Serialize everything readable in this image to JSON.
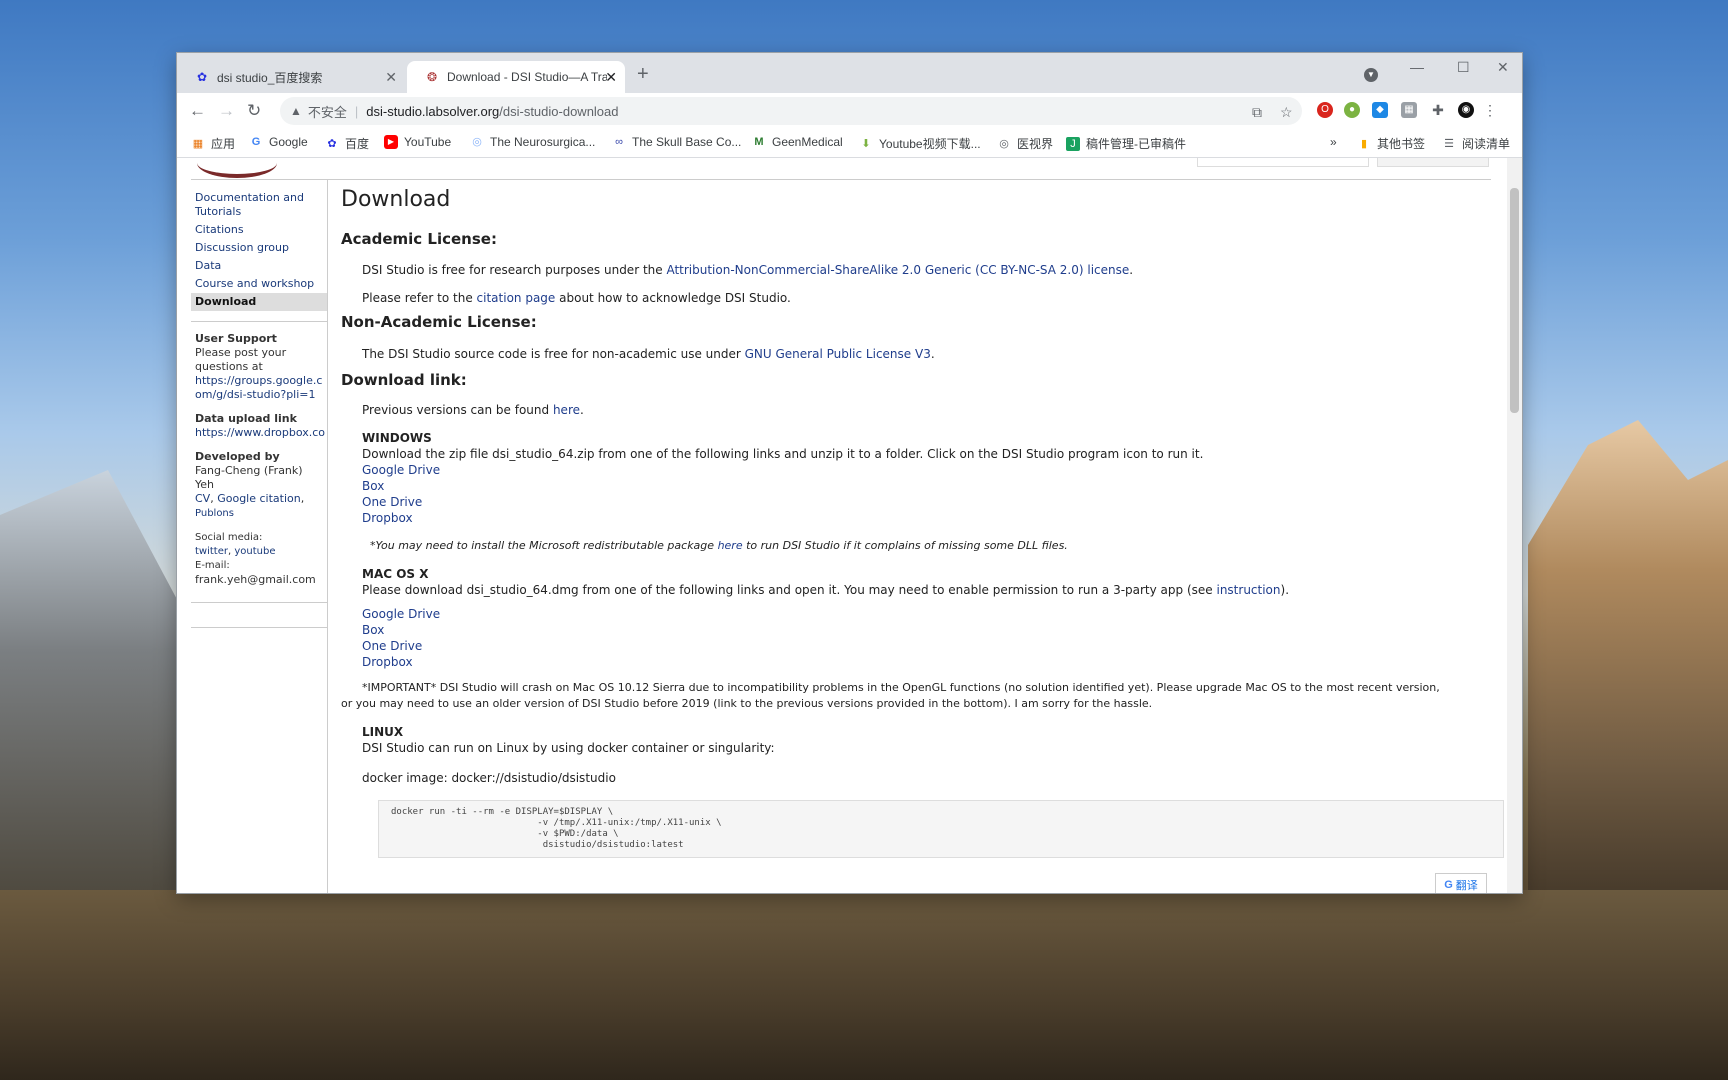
{
  "browser": {
    "tabs": [
      {
        "title": "dsi studio_百度搜索",
        "favicon": "baidu-paw-icon"
      },
      {
        "title": "Download - DSI Studio—A Tra",
        "favicon": "dsi-studio-icon"
      }
    ],
    "new_tab": "+",
    "address": {
      "security": "不安全",
      "host": "dsi-studio.labsolver.org",
      "path": "/dsi-studio-download"
    },
    "bookmarks": [
      {
        "label": "应用",
        "icon": "apps-grid-icon"
      },
      {
        "label": "Google",
        "icon": "google-g-icon"
      },
      {
        "label": "百度",
        "icon": "baidu-paw-icon"
      },
      {
        "label": "YouTube",
        "icon": "youtube-icon"
      },
      {
        "label": "The Neurosurgica...",
        "icon": "globe-icon"
      },
      {
        "label": "The Skull Base Co...",
        "icon": "link-icon"
      },
      {
        "label": "GeenMedical",
        "icon": "geenmedical-icon"
      },
      {
        "label": "Youtube视频下载...",
        "icon": "download-icon"
      },
      {
        "label": "医视界",
        "icon": "globe-icon"
      },
      {
        "label": "稿件管理-已审稿件",
        "icon": "document-icon"
      }
    ],
    "bookmarks_overflow": "»",
    "other_bookmarks": "其他书签",
    "reading_list": "阅读清单"
  },
  "sidebar": {
    "nav": [
      {
        "label": "Documentation and Tutorials"
      },
      {
        "label": "Citations"
      },
      {
        "label": "Discussion group"
      },
      {
        "label": "Data"
      },
      {
        "label": "Course and workshop"
      },
      {
        "label": "Download",
        "active": true
      }
    ],
    "support_title": "User Support",
    "support_text": "Please post your questions at",
    "support_link": "https://groups.google.com/g/dsi-studio?pli=1",
    "upload_title": "Data upload link",
    "upload_link": "https://www.dropbox.com",
    "dev_title": "Developed by",
    "dev_name": "Fang-Cheng (Frank) Yeh",
    "dev_cv": "CV",
    "dev_google": "Google citation",
    "dev_publons": "Publons",
    "social_label": "Social media:",
    "social_twitter": "twitter",
    "social_youtube": "youtube",
    "email_label": "E-mail:",
    "email": "frank.yeh@gmail.com"
  },
  "content": {
    "title": "Download",
    "academic": {
      "heading": "Academic License:",
      "p1_pre": "DSI Studio is free for research purposes under the ",
      "p1_link": "Attribution-NonCommercial-ShareAlike 2.0 Generic (CC BY-NC-SA 2.0) license",
      "p1_post": ".",
      "p2_pre": "Please refer to the ",
      "p2_link": "citation page",
      "p2_post": " about how to acknowledge DSI Studio."
    },
    "nonacademic": {
      "heading": "Non-Academic License:",
      "p_pre": "The DSI Studio source code is free for non-academic use under ",
      "p_link": "GNU General Public License V3",
      "p_post": "."
    },
    "download": {
      "heading": "Download link:",
      "prev_pre": "Previous versions can be found ",
      "prev_link": "here",
      "prev_post": "."
    },
    "windows": {
      "title": "WINDOWS",
      "text": "Download the zip file dsi_studio_64.zip from one of the following links and unzip it to a folder. Click on the DSI Studio program icon to run it.",
      "links": [
        "Google Drive",
        "Box",
        "One Drive",
        "Dropbox"
      ],
      "note_pre": "*You may need to install the Microsoft redistributable package ",
      "note_link": "here",
      "note_post": " to run DSI Studio if it complains of missing some DLL files."
    },
    "mac": {
      "title": "MAC OS X",
      "text_pre": "Please download dsi_studio_64.dmg from one of the following links and open it. You may need to enable permission to run a 3-party app (see ",
      "text_link": "instruction",
      "text_post": ").",
      "links": [
        "Google Drive",
        "Box",
        "One Drive",
        "Dropbox"
      ],
      "important_line1": "*IMPORTANT* DSI Studio will crash on Mac OS 10.12 Sierra due to incompatibility problems in the OpenGL functions (no solution identified yet). Please upgrade Mac OS to the most recent version,",
      "important_line2": "or you may need to use an older version of DSI Studio before 2019 (link to the previous versions provided in the bottom). I am sorry for the hassle."
    },
    "linux": {
      "title": "LINUX",
      "text": "DSI Studio can run on Linux by using docker container or singularity:",
      "docker_image": "docker image: docker://dsistudio/dsistudio",
      "code": "docker run -ti --rm -e DISPLAY=$DISPLAY \\\n                           -v /tmp/.X11-unix:/tmp/.X11-unix \\\n                           -v $PWD:/data \\\n                            dsistudio/dsistudio:latest"
    }
  },
  "translate_badge": "翻译"
}
